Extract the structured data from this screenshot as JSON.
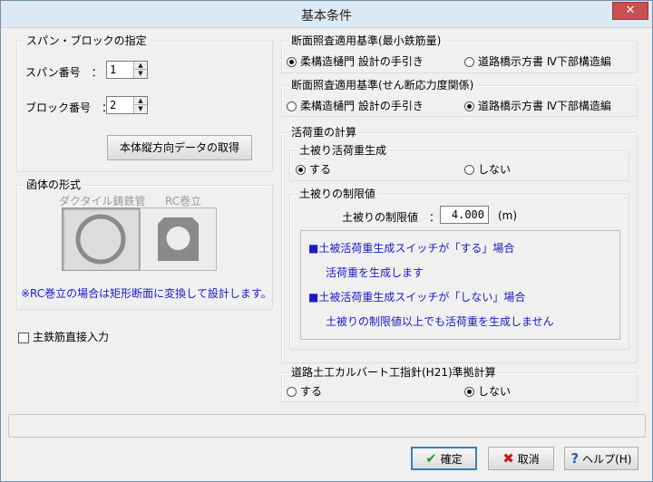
{
  "window": {
    "title": "基本条件",
    "close_label": "✕"
  },
  "span_block": {
    "legend": "スパン・ブロックの指定",
    "span_label": "スパン番号　：",
    "span_value": "1",
    "block_label": "ブロック番号　：",
    "block_value": "2",
    "fetch_button": "本体縦方向データの取得"
  },
  "culvert_type": {
    "legend": "函体の形式",
    "option_ductile": "ダクタイル鋳鉄管",
    "option_rc": "RC巻立",
    "note": "※RC巻立の場合は矩形断面に変換して設計します。"
  },
  "main_rebar_checkbox": "主鉄筋直接入力",
  "section_min_rebar": {
    "legend": "断面照査適用基準(最小鉄筋量)",
    "option1": "柔構造樋門 設計の手引き",
    "option2": "道路橋示方書 Ⅳ下部構造編",
    "selected": 1
  },
  "section_shear": {
    "legend": "断面照査適用基準(せん断応力度関係)",
    "option1": "柔構造樋門 設計の手引き",
    "option2": "道路橋示方書 Ⅳ下部構造編",
    "selected": 2
  },
  "live_load": {
    "legend": "活荷重の計算",
    "cover_gen": {
      "legend": "土被り活荷重生成",
      "option_yes": "する",
      "option_no": "しない",
      "selected": "yes"
    },
    "cover_limit": {
      "legend": "土被りの制限値",
      "label": "土被りの制限値　：",
      "value": "4.000",
      "unit": "(m)",
      "info": [
        "■土被活荷重生成スイッチが「する」場合",
        "活荷重を生成します",
        "■土被活荷重生成スイッチが「しない」場合",
        "土被りの制限値以上でも活荷重を生成しません"
      ]
    }
  },
  "road_culvert": {
    "legend": "道路土工カルバート工指針(H21)準拠計算",
    "option_yes": "する",
    "option_no": "しない",
    "selected": "no"
  },
  "footer": {
    "ok_label": "確定",
    "cancel_label": "取消",
    "help_label": "ヘルプ(H)"
  },
  "colors": {
    "accent_blue": "#1a1ac8",
    "ok_green": "#2e9b2e",
    "cancel_red": "#c81e1e",
    "help_blue": "#2a63b8"
  }
}
